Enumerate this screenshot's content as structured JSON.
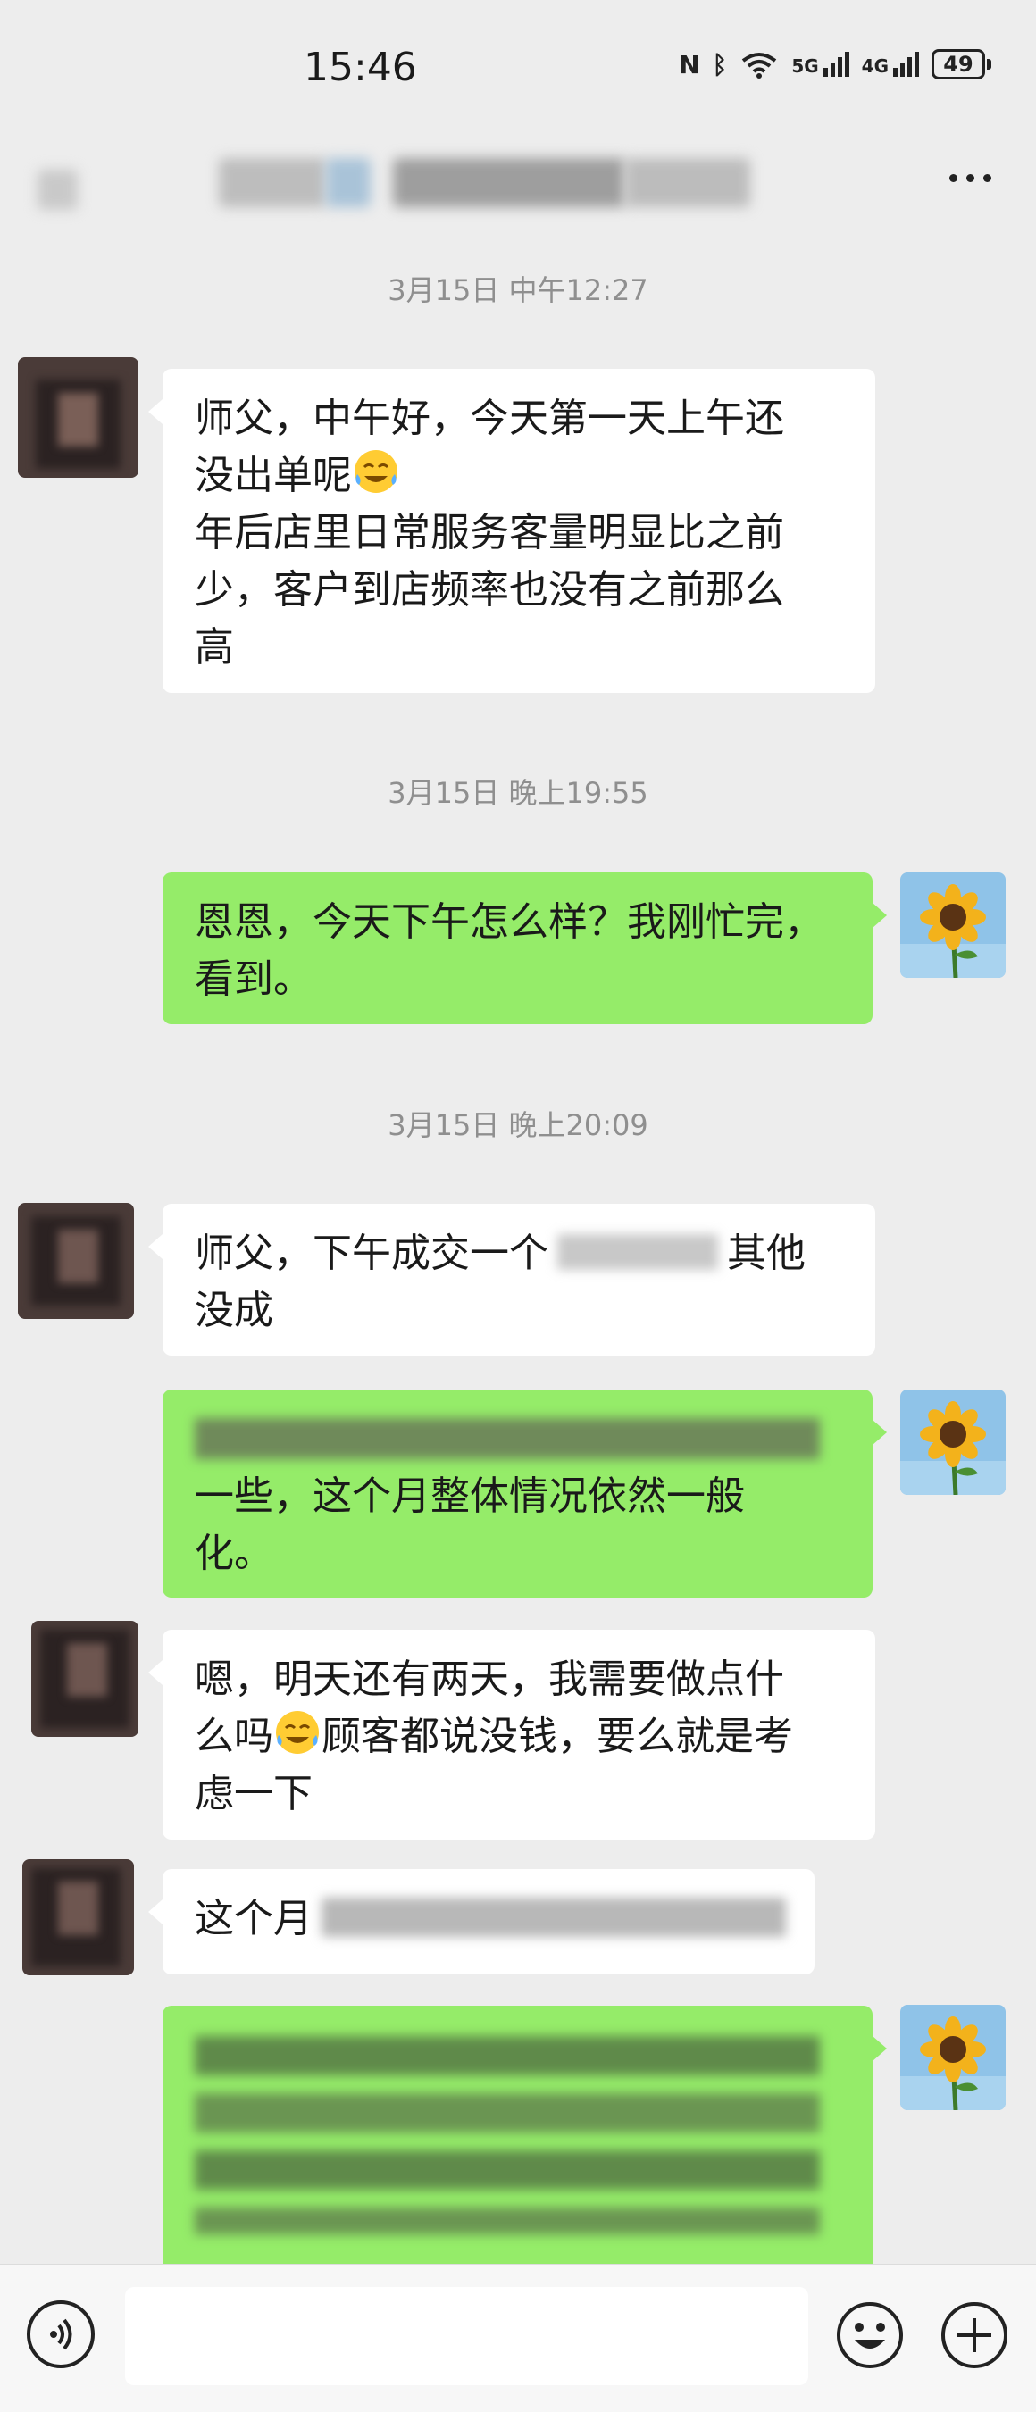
{
  "status_bar": {
    "time": "15:46",
    "network_1": "5G",
    "network_2": "4G",
    "battery": "49"
  },
  "nav": {
    "more_icon": "more-dots-icon"
  },
  "messages": [
    {
      "type": "timestamp",
      "text": "3月15日 中午12:27"
    },
    {
      "type": "received",
      "lines": [
        "师父，中午好，今天第一天上午还",
        "没出单呢",
        "年后店里日常服务客量明显比之前",
        "少，客户到店频率也没有之前那么",
        "高"
      ]
    },
    {
      "type": "timestamp",
      "text": "3月15日 晚上19:55"
    },
    {
      "type": "sent",
      "lines": [
        "恩恩，今天下午怎么样？我刚忙完，",
        "看到。"
      ]
    },
    {
      "type": "timestamp",
      "text": "3月15日 晚上20:09"
    },
    {
      "type": "received",
      "line1_a": "师父，下午成交一个",
      "line1_b": "其他",
      "line2": "没成"
    },
    {
      "type": "sent",
      "visible_lines": [
        "一些，这个月整体情况依然一般",
        "化。"
      ]
    },
    {
      "type": "received",
      "lines": [
        "嗯，明天还有两天，我需要做点什",
        "么吗",
        "顾客都说没钱，要么就是考",
        "虑一下"
      ]
    },
    {
      "type": "received",
      "visible_prefix": "这个月"
    }
  ],
  "icons": {
    "emoji_crying": "laughing-crying-emoji-icon",
    "voice": "voice-input-icon",
    "emoji_button": "smiley-face-icon",
    "plus_button": "plus-icon"
  },
  "colors": {
    "background": "#ededed",
    "sent_bubble": "#95ec69",
    "received_bubble": "#ffffff",
    "timestamp_text": "#8f8f8f"
  }
}
